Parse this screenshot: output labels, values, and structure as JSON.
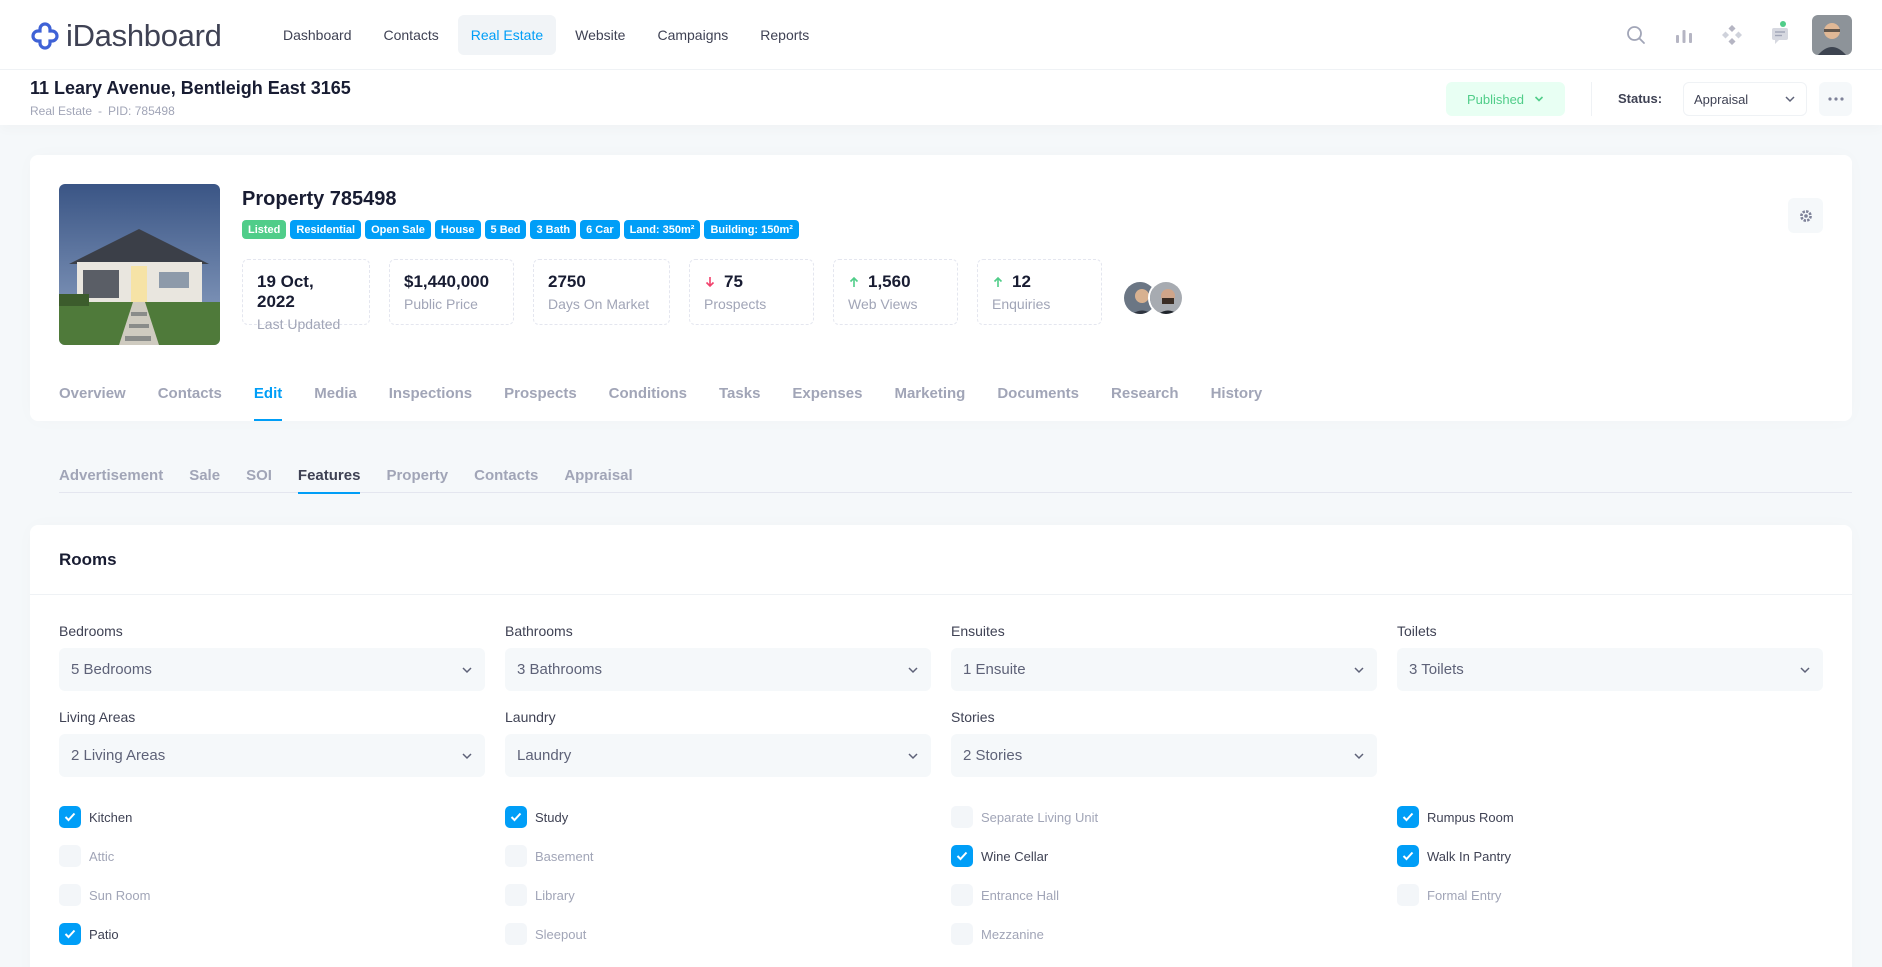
{
  "app": {
    "name": "iDashboard"
  },
  "nav": [
    {
      "label": "Dashboard"
    },
    {
      "label": "Contacts"
    },
    {
      "label": "Real Estate",
      "active": true
    },
    {
      "label": "Website"
    },
    {
      "label": "Campaigns"
    },
    {
      "label": "Reports"
    }
  ],
  "toolbar": {
    "title": "11 Leary Avenue, Bentleigh East 3165",
    "crumb_section": "Real Estate",
    "crumb_sep": "-",
    "crumb_pid": "PID: 785498",
    "published_label": "Published",
    "status_label": "Status:",
    "status_value": "Appraisal"
  },
  "property": {
    "title": "Property 785498",
    "badges": [
      {
        "label": "Listed",
        "color": "#50cd89"
      },
      {
        "label": "Residential"
      },
      {
        "label": "Open Sale"
      },
      {
        "label": "House"
      },
      {
        "label": "5 Bed"
      },
      {
        "label": "3 Bath"
      },
      {
        "label": "6 Car"
      },
      {
        "label": "Land: 350m²"
      },
      {
        "label": "Building: 150m²"
      }
    ],
    "stats": [
      {
        "value": "19 Oct, 2022",
        "label": "Last Updated",
        "trend": ""
      },
      {
        "value": "$1,440,000",
        "label": "Public Price",
        "trend": ""
      },
      {
        "value": "2750",
        "label": "Days On Market",
        "trend": ""
      },
      {
        "value": "75",
        "label": "Prospects",
        "trend": "down"
      },
      {
        "value": "1,560",
        "label": "Web Views",
        "trend": "up"
      },
      {
        "value": "12",
        "label": "Enquiries",
        "trend": "up"
      }
    ]
  },
  "tabs": [
    {
      "label": "Overview"
    },
    {
      "label": "Contacts"
    },
    {
      "label": "Edit",
      "active": true
    },
    {
      "label": "Media"
    },
    {
      "label": "Inspections"
    },
    {
      "label": "Prospects"
    },
    {
      "label": "Conditions"
    },
    {
      "label": "Tasks"
    },
    {
      "label": "Expenses"
    },
    {
      "label": "Marketing"
    },
    {
      "label": "Documents"
    },
    {
      "label": "Research"
    },
    {
      "label": "History"
    }
  ],
  "subtabs": [
    {
      "label": "Advertisement"
    },
    {
      "label": "Sale"
    },
    {
      "label": "SOI"
    },
    {
      "label": "Features",
      "active": true
    },
    {
      "label": "Property"
    },
    {
      "label": "Contacts"
    },
    {
      "label": "Appraisal"
    }
  ],
  "rooms": {
    "title": "Rooms",
    "fields": [
      {
        "label": "Bedrooms",
        "value": "5 Bedrooms"
      },
      {
        "label": "Bathrooms",
        "value": "3 Bathrooms"
      },
      {
        "label": "Ensuites",
        "value": "1 Ensuite"
      },
      {
        "label": "Toilets",
        "value": "3 Toilets"
      },
      {
        "label": "Living Areas",
        "value": "2 Living Areas"
      },
      {
        "label": "Laundry",
        "value": "Laundry"
      },
      {
        "label": "Stories",
        "value": "2 Stories"
      }
    ],
    "checks": [
      {
        "label": "Kitchen",
        "checked": true
      },
      {
        "label": "Study",
        "checked": true
      },
      {
        "label": "Separate Living Unit",
        "checked": false
      },
      {
        "label": "Rumpus Room",
        "checked": true
      },
      {
        "label": "Attic",
        "checked": false
      },
      {
        "label": "Basement",
        "checked": false
      },
      {
        "label": "Wine Cellar",
        "checked": true
      },
      {
        "label": "Walk In Pantry",
        "checked": true
      },
      {
        "label": "Sun Room",
        "checked": false
      },
      {
        "label": "Library",
        "checked": false
      },
      {
        "label": "Entrance Hall",
        "checked": false
      },
      {
        "label": "Formal Entry",
        "checked": false
      },
      {
        "label": "Patio",
        "checked": true
      },
      {
        "label": "Sleepout",
        "checked": false
      },
      {
        "label": "Mezzanine",
        "checked": false
      }
    ]
  },
  "colors": {
    "accent": "#009ef7",
    "success": "#50cd89",
    "warning": "#f1416c"
  }
}
